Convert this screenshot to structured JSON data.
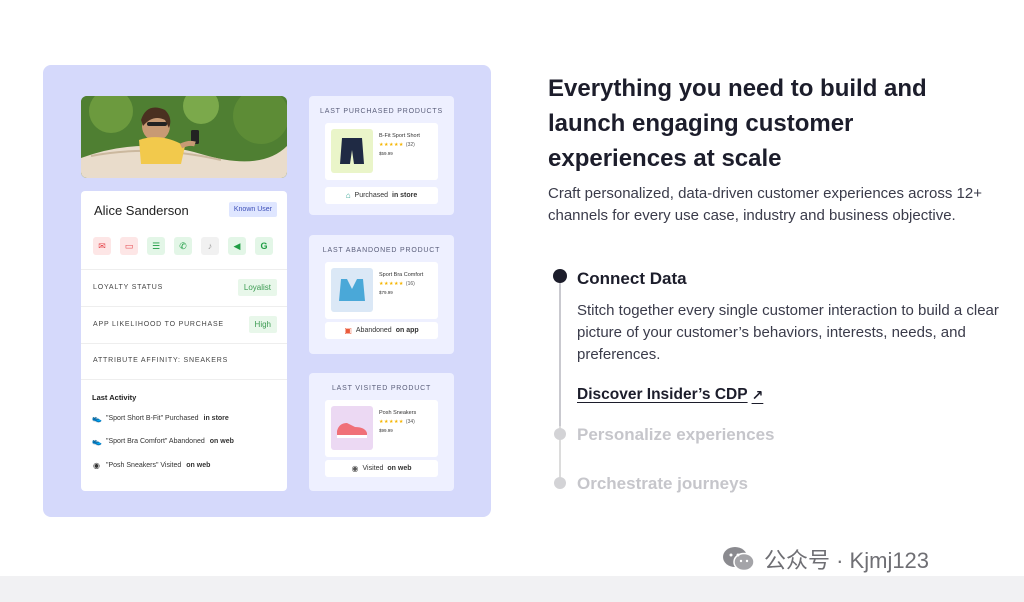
{
  "headline": "Everything you need to build and launch engaging customer experiences at scale",
  "lead": "Craft personalized, data-driven customer experiences across 12+ channels for every use case, industry and business objective.",
  "steps": [
    {
      "title": "Connect Data",
      "description": "Stitch together every single customer interaction to build a clear picture of your customer’s behaviors, interests, needs, and preferences.",
      "link": "Discover Insider’s CDP",
      "link_icon": "↗"
    },
    {
      "title": "Personalize experiences"
    },
    {
      "title": "Orchestrate journeys"
    }
  ],
  "profile": {
    "name": "Alice Sanderson",
    "badge": "Known User",
    "channels": [
      {
        "icon": "email-icon",
        "glyph": "✉"
      },
      {
        "icon": "web-push-icon",
        "glyph": "▭"
      },
      {
        "icon": "sms-icon",
        "glyph": "☰"
      },
      {
        "icon": "whatsapp-icon",
        "glyph": "✆"
      },
      {
        "icon": "tiktok-icon",
        "glyph": "♪"
      },
      {
        "icon": "megaphone-icon",
        "glyph": "◀"
      },
      {
        "icon": "google-icon",
        "glyph": "G"
      }
    ],
    "loyalty_label": "LOYALTY STATUS",
    "loyalty_value": "Loyalist",
    "app_label": "APP LIKELIHOOD TO PURCHASE",
    "app_value": "High",
    "affinity_label": "ATTRIBUTE AFFINITY: SNEAKERS",
    "activity_title": "Last Activity",
    "activities": [
      {
        "text": "\"Sport Short B-Fit\" Purchased",
        "bold": "in store"
      },
      {
        "text": "\"Sport Bra Comfort\" Abandoned",
        "bold": "on web"
      },
      {
        "text": "\"Posh Sneakers\" Visited",
        "bold": "on web"
      }
    ]
  },
  "cards": [
    {
      "title": "LAST PURCHASED PRODUCTS",
      "product_name": "B-Fit Sport Short",
      "stars": "★★★★★",
      "rating_count": "(32)",
      "price": "$59.99",
      "foot_text": "Purchased",
      "foot_bold": "in store"
    },
    {
      "title": "LAST ABANDONED PRODUCT",
      "product_name": "Sport Bra Comfort",
      "stars": "★★★★★",
      "rating_count": "(16)",
      "price": "$79.99",
      "foot_text": "Abandoned",
      "foot_bold": "on app"
    },
    {
      "title": "LAST VISITED PRODUCT",
      "product_name": "Posh Sneakers",
      "stars": "★★★★★",
      "rating_count": "(34)",
      "price": "$99.99",
      "foot_text": "Visited",
      "foot_bold": "on web"
    }
  ],
  "watermark": "公众号 · Kjmj123",
  "colors": {
    "panel": "#d5d9fb",
    "card": "#eef0ff",
    "ink": "#1c1d2b",
    "muted_step": "#c6c6cb",
    "pill_green": "#e8f7ea",
    "badge_blue": "#dfe6ff"
  }
}
